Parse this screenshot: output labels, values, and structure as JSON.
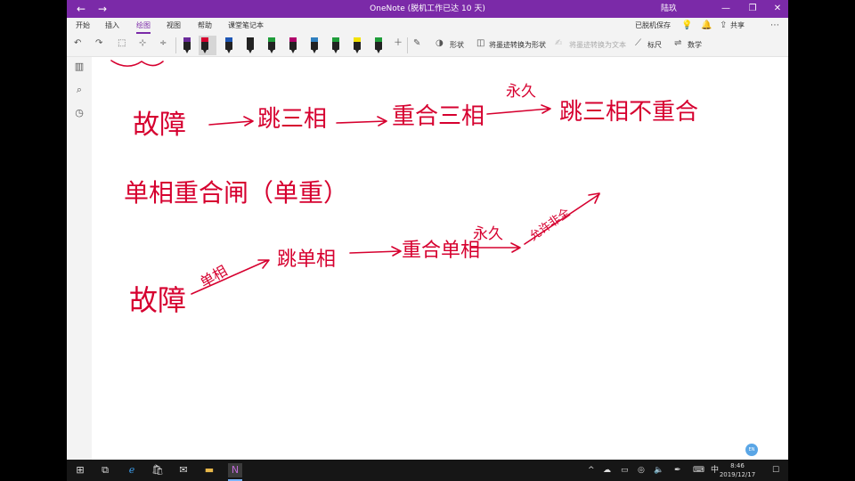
{
  "titlebar": {
    "back": "←",
    "forward": "→",
    "title": "OneNote (脱机工作已达 10 天)",
    "user": "陆玖",
    "minimize": "—",
    "restore": "❐",
    "close": "✕"
  },
  "ribbon": {
    "tabs": [
      "开始",
      "插入",
      "绘图",
      "视图",
      "帮助",
      "课堂笔记本"
    ],
    "active_tab": "绘图",
    "status": "已脱机保存",
    "share": "共享",
    "commands": {
      "shapes": "形状",
      "ink_to_shape": "将墨迹转换为形状",
      "ink_to_text": "将墨迹转换为文本",
      "ruler": "标尺",
      "math": "数学"
    },
    "pen_colors": [
      "#6a2b9a",
      "#d6002f",
      "#1e56b4",
      "#222222",
      "#1f9d3a",
      "#b0006a",
      "#2f7fbf",
      "#1f9d3a",
      "#f2e100",
      "#1f9d3a"
    ]
  },
  "ink": {
    "line1": [
      "故障",
      "跳三相",
      "重合三相",
      "永久",
      "跳三相不重合"
    ],
    "line2": "单相重合闸（单重）",
    "line3": [
      "故障",
      "单相",
      "跳单相",
      "重合单相",
      "永久",
      "允许非全"
    ]
  },
  "fab_label": "EN",
  "taskbar": {
    "ime": "中",
    "time": "8:46",
    "date": "2019/12/17"
  },
  "colors": {
    "accent": "#7b2aa8",
    "ink": "#d6002f"
  }
}
